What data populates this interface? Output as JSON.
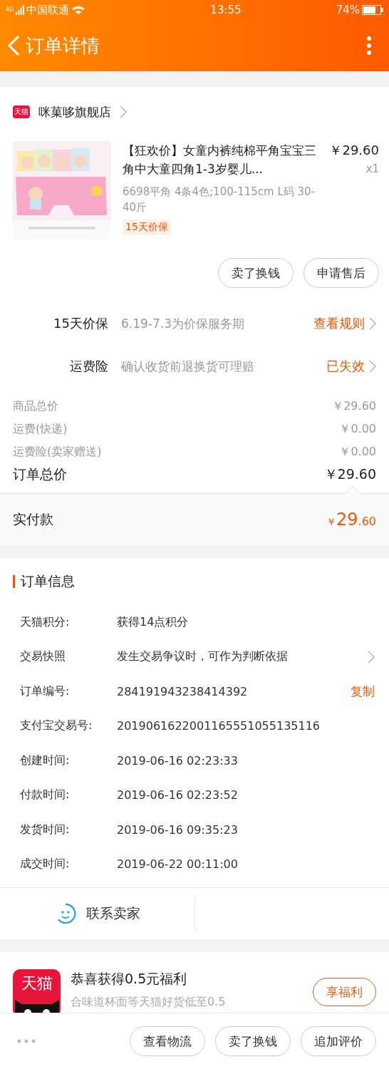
{
  "status_bar": {
    "network": "4G",
    "carrier": "中国联通",
    "time": "13:55",
    "battery": "74%"
  },
  "header": {
    "title": "订单详情"
  },
  "store": {
    "badge": "天猫",
    "name": "咪菓哆旗舰店"
  },
  "product": {
    "title": "【狂欢价】女童内裤纯棉平角宝宝三角中大童四角1-3岁婴儿...",
    "price": "￥29.60",
    "quantity": "x1",
    "spec": "6698平角 4条4色;100-115cm L码 30-40斤",
    "tag": "15天价保"
  },
  "item_buttons": [
    "卖了换钱",
    "申请售后"
  ],
  "services": [
    {
      "label": "15天价保",
      "desc": "6.19-7.3为价保服务期",
      "action": "查看规则"
    },
    {
      "label": "运费险",
      "desc": "确认收货前退换货可理赔",
      "action": "已失效"
    }
  ],
  "costs": [
    {
      "label": "商品总价",
      "value": "￥29.60",
      "kind": "minor"
    },
    {
      "label": "运费(快递)",
      "value": "￥0.00",
      "kind": "minor"
    },
    {
      "label": "运费险(卖家赠送)",
      "value": "￥0.00",
      "kind": "minor"
    },
    {
      "label": "订单总价",
      "value": "￥29.60",
      "kind": "total"
    }
  ],
  "paid": {
    "label": "实付款",
    "currency": "￥",
    "integer": "29",
    "decimal": ".60"
  },
  "order_info": {
    "title": "订单信息",
    "rows": [
      {
        "label": "天猫积分:",
        "value": "获得14点积分"
      },
      {
        "label": "交易快照",
        "value": "发生交易争议时，可作为判断依据",
        "kind": "link"
      },
      {
        "label": "订单编号:",
        "value": "284191943238414392",
        "action": "复制"
      },
      {
        "label": "支付宝交易号:",
        "value": "2019061622001165551055135116"
      },
      {
        "label": "创建时间:",
        "value": "2019-06-16 02:23:33"
      },
      {
        "label": "付款时间:",
        "value": "2019-06-16 02:23:52"
      },
      {
        "label": "发货时间:",
        "value": "2019-06-16 09:35:23"
      },
      {
        "label": "成交时间:",
        "value": "2019-06-22 00:11:00"
      }
    ],
    "contact": "联系卖家"
  },
  "promo": {
    "logo": "天猫",
    "title": "恭喜获得0.5元福利",
    "subtitle": "合味道杯面等天猫好货低至0.5",
    "button": "享福利"
  },
  "bottom_buttons": [
    "查看物流",
    "卖了换钱",
    "追加评价"
  ]
}
